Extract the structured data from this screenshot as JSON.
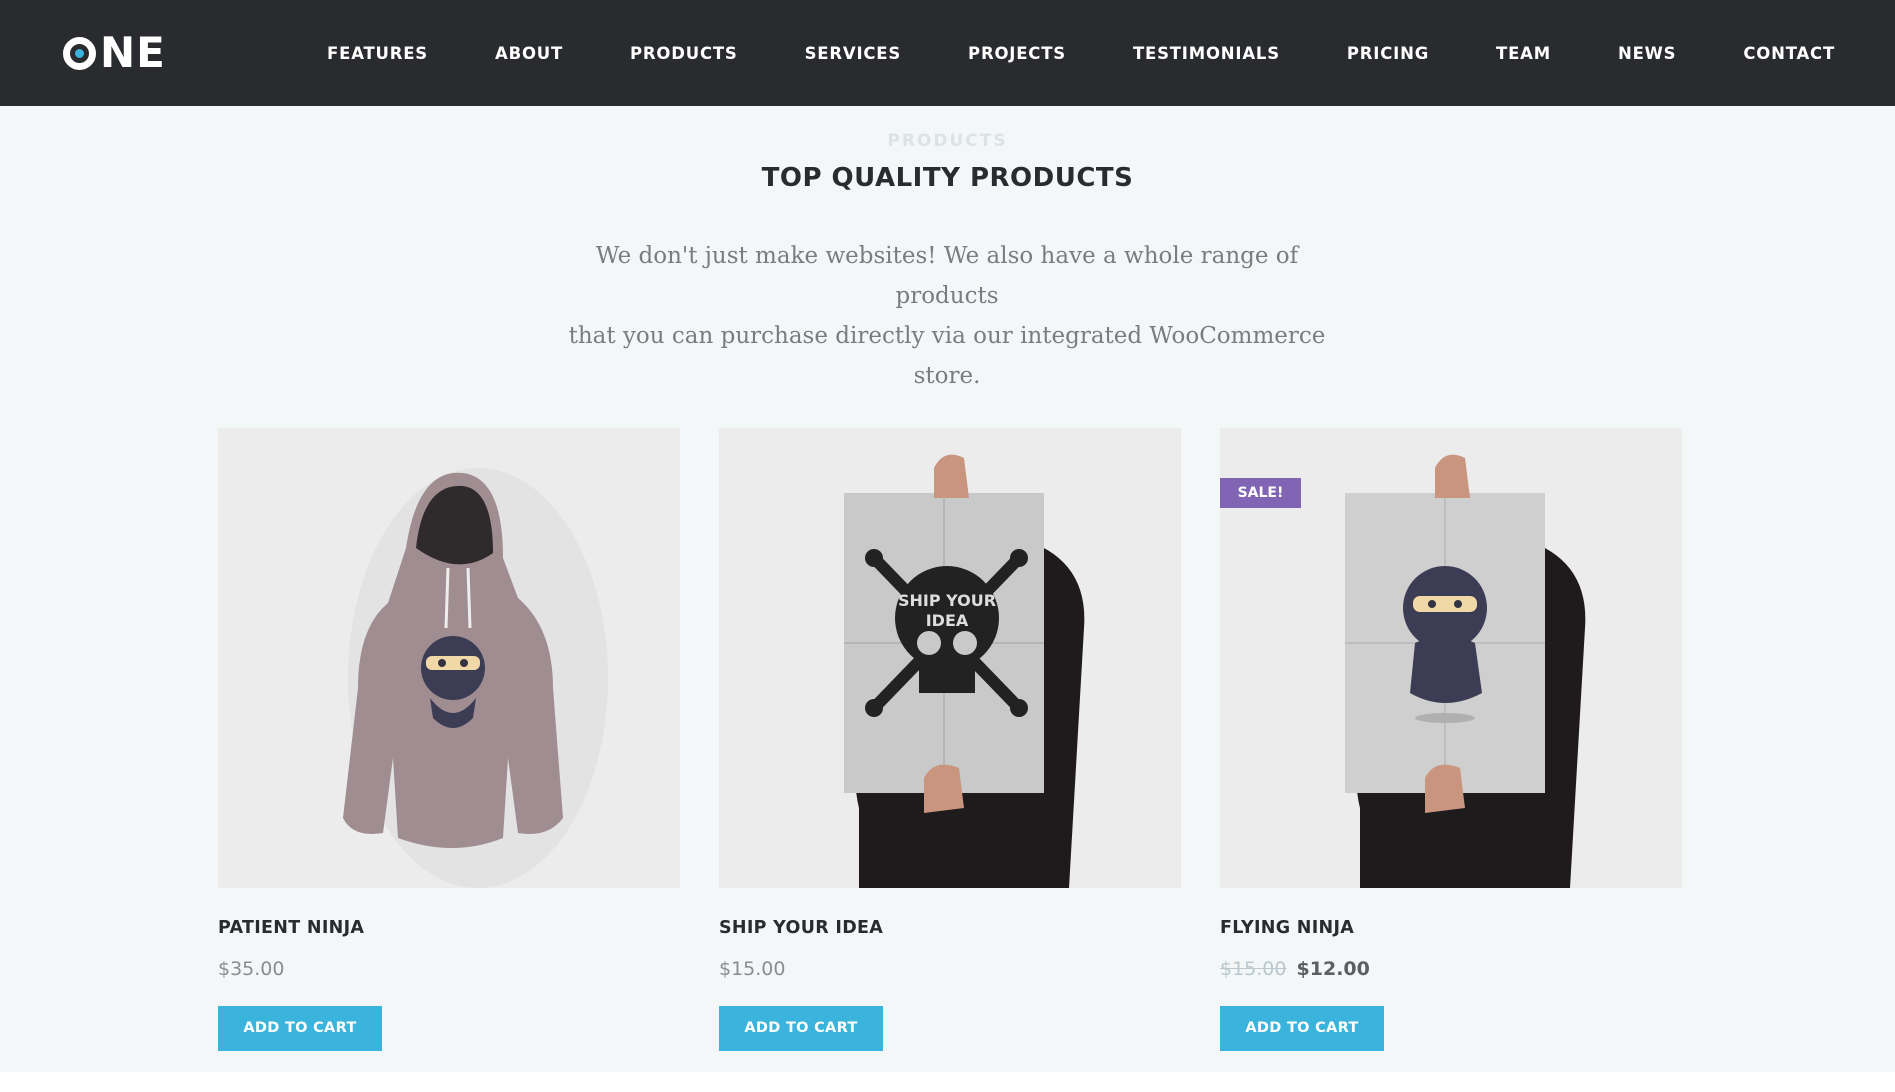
{
  "header": {
    "logo": "ONE",
    "nav": [
      "FEATURES",
      "ABOUT",
      "PRODUCTS",
      "SERVICES",
      "PROJECTS",
      "TESTIMONIALS",
      "PRICING",
      "TEAM",
      "NEWS",
      "CONTACT"
    ]
  },
  "section": {
    "eyebrow": "PRODUCTS",
    "title": "TOP QUALITY PRODUCTS",
    "intro_line1": "We don't just make websites! We also have a whole range of products",
    "intro_line2": "that you can purchase directly via our integrated WooCommerce store."
  },
  "products": [
    {
      "name": "PATIENT NINJA",
      "price": "$35.00",
      "button": "ADD TO CART",
      "image_icon": "ninja-hoodie-icon"
    },
    {
      "name": "SHIP YOUR IDEA",
      "price": "$15.00",
      "button": "ADD TO CART",
      "image_icon": "skull-poster-icon"
    },
    {
      "name": "FLYING NINJA",
      "old_price": "$15.00",
      "price": "$12.00",
      "button": "ADD TO CART",
      "badge": "SALE!",
      "image_icon": "ninja-poster-icon"
    }
  ],
  "colors": {
    "header_bg": "#2a2b2f",
    "section_bg": "#f4f7f8",
    "accent": "#3ab4dc",
    "sale_badge": "#8165b4"
  }
}
